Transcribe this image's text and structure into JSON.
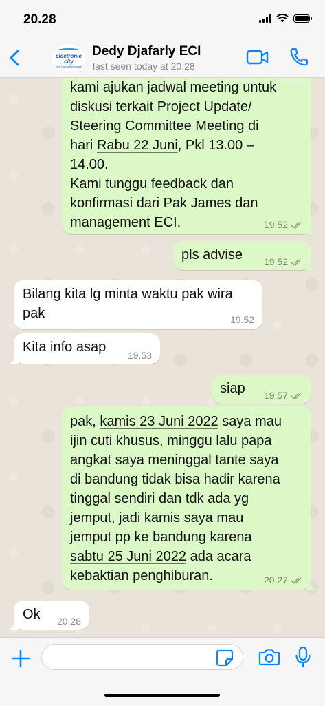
{
  "status_bar": {
    "time": "20.28"
  },
  "header": {
    "contact_name": "Dedy Djafarly ECI",
    "last_seen": "last seen today at 20.28",
    "avatar_logo": {
      "line1": "electronic",
      "line2": "city",
      "line3": "Light Up your Moments"
    },
    "accent_color": "#0a84ff"
  },
  "messages": [
    {
      "direction": "out",
      "lines": [
        "kami ajukan jadwal meeting untuk",
        "diskusi terkait Project Update/",
        "Steering Committee Meeting di",
        "hari Rabu 22 Juni, Pkl 13.00 –",
        "14.00.",
        "Kami tunggu feedback dan",
        "konfirmasi dari Pak James dan",
        "management ECI."
      ],
      "time": "19.52"
    },
    {
      "direction": "out",
      "text": "pls advise",
      "time": "19.52"
    },
    {
      "direction": "in",
      "lines": [
        "Bilang kita lg minta waktu pak wira",
        "pak"
      ],
      "time": "19.52"
    },
    {
      "direction": "in",
      "text": "Kita info asap",
      "time": "19.53"
    },
    {
      "direction": "out",
      "text": "siap",
      "time": "19.57"
    },
    {
      "direction": "out",
      "lines": [
        "pak, kamis 23 Juni 2022 saya mau",
        "ijin cuti khusus, minggu lalu papa",
        "angkat saya meninggal tante saya",
        "di bandung tidak bisa hadir karena",
        "tinggal sendiri dan tdk ada yg",
        "jemput, jadi kamis saya mau",
        "jemput pp ke bandung karena",
        "sabtu 25 Juni 2022 ada acara",
        "kebaktian penghiburan."
      ],
      "time": "20.27"
    },
    {
      "direction": "in",
      "text": "Ok",
      "time": "20.28"
    }
  ],
  "input": {
    "value": "",
    "placeholder": ""
  },
  "icons": {
    "back": "chevron-left-icon",
    "video": "video-camera-icon",
    "phone": "phone-icon",
    "attach": "plus-icon",
    "sticker": "sticker-icon",
    "camera": "camera-icon",
    "mic": "microphone-icon",
    "read_receipt": "double-check-icon"
  },
  "colors": {
    "outgoing_bubble": "#dcf8c6",
    "incoming_bubble": "#ffffff",
    "chat_background": "#e9e3da",
    "ios_blue": "#0a84ff"
  }
}
